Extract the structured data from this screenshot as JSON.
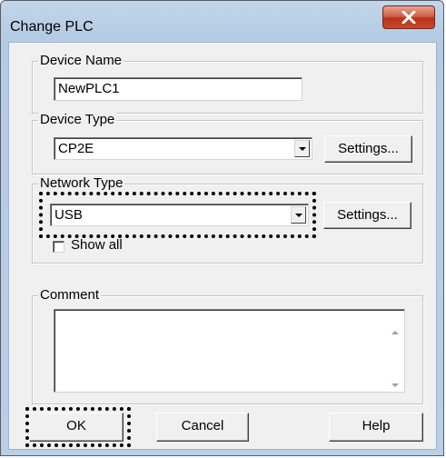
{
  "window": {
    "title": "Change PLC",
    "close_icon": "close-x-icon"
  },
  "device_name": {
    "label": "Device Name",
    "value": "NewPLC1"
  },
  "device_type": {
    "label": "Device Type",
    "selected": "CP2E",
    "settings_label": "Settings..."
  },
  "network_type": {
    "label": "Network Type",
    "selected": "USB",
    "settings_label": "Settings...",
    "show_all_label": "Show all",
    "show_all_checked": false
  },
  "comment": {
    "label": "Comment",
    "value": ""
  },
  "buttons": {
    "ok": "OK",
    "cancel": "Cancel",
    "help": "Help"
  }
}
